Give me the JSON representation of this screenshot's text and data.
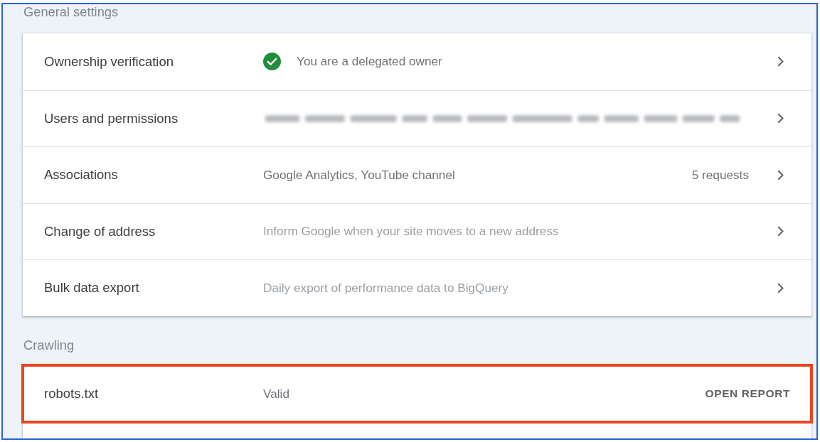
{
  "sections": [
    {
      "title": "General settings",
      "rows": [
        {
          "label": "Ownership verification",
          "kind": "verified",
          "value": "You are a delegated owner"
        },
        {
          "label": "Users and permissions",
          "kind": "redacted"
        },
        {
          "label": "Associations",
          "kind": "value",
          "value": "Google Analytics, YouTube channel",
          "count": "5 requests"
        },
        {
          "label": "Change of address",
          "kind": "hint",
          "value": "Inform Google when your site moves to a new address"
        },
        {
          "label": "Bulk data export",
          "kind": "hint",
          "value": "Daily export of performance data to BigQuery"
        }
      ]
    },
    {
      "title": "Crawling",
      "rows": [
        {
          "label": "robots.txt",
          "kind": "value",
          "value": "Valid",
          "action": "OPEN REPORT",
          "highlighted": true
        }
      ]
    }
  ]
}
